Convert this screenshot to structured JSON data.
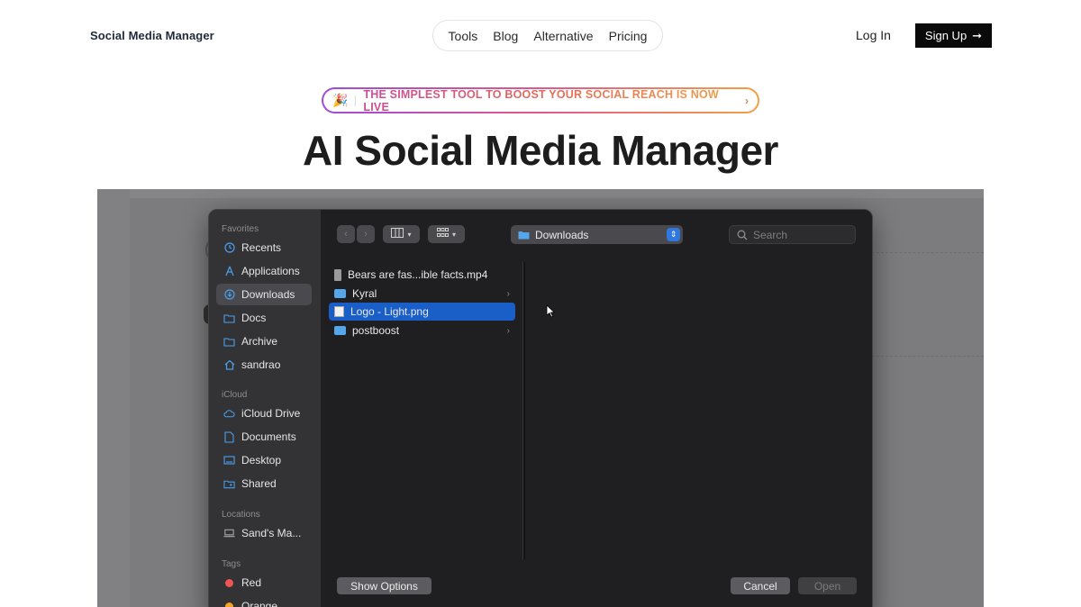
{
  "header": {
    "brand": "Social Media Manager",
    "nav": [
      "Tools",
      "Blog",
      "Alternative",
      "Pricing"
    ],
    "login": "Log In",
    "signup": "Sign Up",
    "signup_arrow": "➞"
  },
  "banner": {
    "icon": "🎉",
    "text": "THE SIMPLEST TOOL TO BOOST YOUR SOCIAL REACH IS NOW LIVE",
    "chevron": "›"
  },
  "hero": {
    "title": "AI Social Media Manager"
  },
  "dialog": {
    "sidebar": {
      "favorites_label": "Favorites",
      "favorites": [
        {
          "label": "Recents",
          "icon": "clock-icon"
        },
        {
          "label": "Applications",
          "icon": "applications-icon"
        },
        {
          "label": "Downloads",
          "icon": "download-icon"
        },
        {
          "label": "Docs",
          "icon": "folder-icon"
        },
        {
          "label": "Archive",
          "icon": "folder-icon"
        },
        {
          "label": "sandrao",
          "icon": "home-icon"
        }
      ],
      "icloud_label": "iCloud",
      "icloud": [
        {
          "label": "iCloud Drive",
          "icon": "cloud-icon"
        },
        {
          "label": "Documents",
          "icon": "document-icon"
        },
        {
          "label": "Desktop",
          "icon": "desktop-icon"
        },
        {
          "label": "Shared",
          "icon": "shared-folder-icon"
        }
      ],
      "locations_label": "Locations",
      "locations": [
        {
          "label": "Sand's Ma...",
          "icon": "laptop-icon"
        }
      ],
      "tags_label": "Tags",
      "tags": [
        {
          "label": "Red",
          "color": "#f05454"
        },
        {
          "label": "Orange",
          "color": "#f5a524"
        }
      ]
    },
    "toolbar": {
      "location": "Downloads",
      "search_placeholder": "Search"
    },
    "files": [
      {
        "name": "Bears are fas...ible facts.mp4",
        "type": "video",
        "folder": false
      },
      {
        "name": "Kyral",
        "type": "folder",
        "folder": true
      },
      {
        "name": "Logo - Light.png",
        "type": "image",
        "folder": false,
        "selected": true
      },
      {
        "name": "postboost",
        "type": "folder",
        "folder": true
      }
    ],
    "buttons": {
      "show_options": "Show Options",
      "cancel": "Cancel",
      "open": "Open"
    }
  }
}
